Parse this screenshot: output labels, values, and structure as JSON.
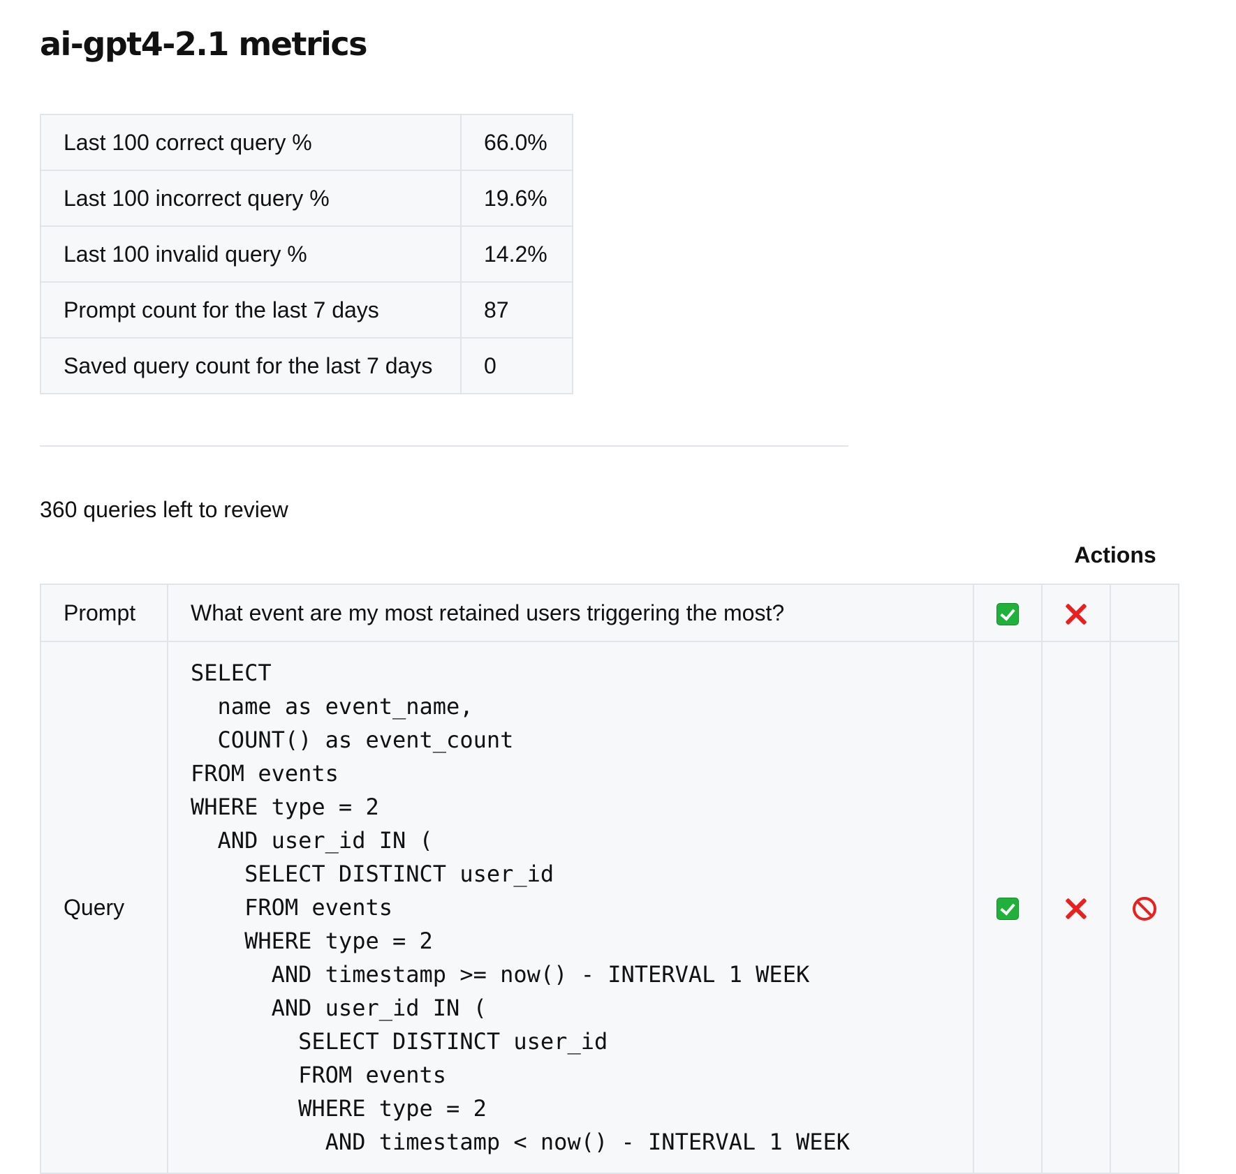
{
  "title": "ai-gpt4-2.1 metrics",
  "metrics": [
    {
      "label": "Last 100 correct query %",
      "value": "66.0%"
    },
    {
      "label": "Last 100 incorrect query %",
      "value": "19.6%"
    },
    {
      "label": "Last 100 invalid query %",
      "value": "14.2%"
    },
    {
      "label": "Prompt count for the last 7 days",
      "value": "87"
    },
    {
      "label": "Saved query count for the last 7 days",
      "value": "0"
    }
  ],
  "review": {
    "remaining_text": "360 queries left to review",
    "actions_header": "Actions",
    "prompt_label": "Prompt",
    "prompt_text": "What event are my most retained users triggering the most?",
    "query_label": "Query",
    "query_sql": "SELECT\n  name as event_name,\n  COUNT() as event_count\nFROM events\nWHERE type = 2\n  AND user_id IN (\n    SELECT DISTINCT user_id\n    FROM events\n    WHERE type = 2\n      AND timestamp >= now() - INTERVAL 1 WEEK\n      AND user_id IN (\n        SELECT DISTINCT user_id\n        FROM events\n        WHERE type = 2\n          AND timestamp < now() - INTERVAL 1 WEEK"
  },
  "icons": {
    "correct": "check-mark-button-icon",
    "incorrect": "cross-mark-icon",
    "invalid": "prohibited-icon"
  },
  "colors": {
    "correct": "#20b13a",
    "incorrect": "#e8201e",
    "table_background": "#f6f8fa",
    "border": "#e1e4e8"
  }
}
